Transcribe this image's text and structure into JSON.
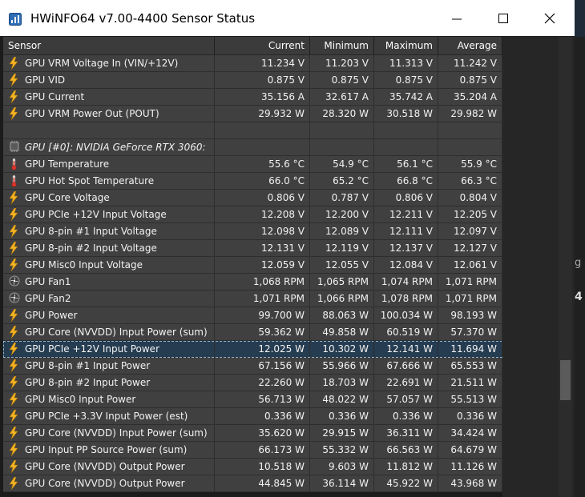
{
  "window": {
    "title": "HWiNFO64 v7.00-4400 Sensor Status",
    "minimize": "minimize",
    "maximize": "maximize",
    "close": "close"
  },
  "columns": [
    "Sensor",
    "Current",
    "Minimum",
    "Maximum",
    "Average"
  ],
  "rows": [
    {
      "type": "sensor",
      "icon": "lightning-icon",
      "name": "GPU VRM Voltage In (VIN/+12V)",
      "cur": "11.234 V",
      "min": "11.203 V",
      "max": "11.313 V",
      "avg": "11.242 V"
    },
    {
      "type": "sensor",
      "icon": "lightning-icon",
      "name": "GPU VID",
      "cur": "0.875 V",
      "min": "0.875 V",
      "max": "0.875 V",
      "avg": "0.875 V"
    },
    {
      "type": "sensor",
      "icon": "lightning-icon",
      "name": "GPU Current",
      "cur": "35.156 A",
      "min": "32.617 A",
      "max": "35.742 A",
      "avg": "35.204 A"
    },
    {
      "type": "sensor",
      "icon": "lightning-icon",
      "name": "GPU VRM Power Out (POUT)",
      "cur": "29.932 W",
      "min": "28.320 W",
      "max": "30.518 W",
      "avg": "29.982 W"
    },
    {
      "type": "blank"
    },
    {
      "type": "group",
      "icon": "chip-icon",
      "name": "GPU [#0]: NVIDIA GeForce RTX 3060:"
    },
    {
      "type": "sensor",
      "icon": "thermometer-icon",
      "name": "GPU Temperature",
      "cur": "55.6 °C",
      "min": "54.9 °C",
      "max": "56.1 °C",
      "avg": "55.9 °C"
    },
    {
      "type": "sensor",
      "icon": "thermometer-icon",
      "name": "GPU Hot Spot Temperature",
      "cur": "66.0 °C",
      "min": "65.2 °C",
      "max": "66.8 °C",
      "avg": "66.3 °C"
    },
    {
      "type": "sensor",
      "icon": "lightning-icon",
      "name": "GPU Core Voltage",
      "cur": "0.806 V",
      "min": "0.787 V",
      "max": "0.806 V",
      "avg": "0.804 V"
    },
    {
      "type": "sensor",
      "icon": "lightning-icon",
      "name": "GPU PCIe +12V Input Voltage",
      "cur": "12.208 V",
      "min": "12.200 V",
      "max": "12.211 V",
      "avg": "12.205 V"
    },
    {
      "type": "sensor",
      "icon": "lightning-icon",
      "name": "GPU 8-pin #1 Input Voltage",
      "cur": "12.098 V",
      "min": "12.089 V",
      "max": "12.111 V",
      "avg": "12.097 V"
    },
    {
      "type": "sensor",
      "icon": "lightning-icon",
      "name": "GPU 8-pin #2 Input Voltage",
      "cur": "12.131 V",
      "min": "12.119 V",
      "max": "12.137 V",
      "avg": "12.127 V"
    },
    {
      "type": "sensor",
      "icon": "lightning-icon",
      "name": "GPU Misc0 Input Voltage",
      "cur": "12.059 V",
      "min": "12.055 V",
      "max": "12.084 V",
      "avg": "12.061 V"
    },
    {
      "type": "sensor",
      "icon": "fan-icon",
      "name": "GPU Fan1",
      "cur": "1,068 RPM",
      "min": "1,065 RPM",
      "max": "1,074 RPM",
      "avg": "1,071 RPM"
    },
    {
      "type": "sensor",
      "icon": "fan-icon",
      "name": "GPU Fan2",
      "cur": "1,071 RPM",
      "min": "1,066 RPM",
      "max": "1,078 RPM",
      "avg": "1,071 RPM"
    },
    {
      "type": "sensor",
      "icon": "lightning-icon",
      "name": "GPU Power",
      "cur": "99.700 W",
      "min": "88.063 W",
      "max": "100.034 W",
      "avg": "98.193 W"
    },
    {
      "type": "sensor",
      "icon": "lightning-icon",
      "name": "GPU Core (NVVDD) Input Power (sum)",
      "cur": "59.362 W",
      "min": "49.858 W",
      "max": "60.519 W",
      "avg": "57.370 W"
    },
    {
      "type": "sensor",
      "icon": "lightning-icon",
      "name": "GPU PCIe +12V Input Power",
      "cur": "12.025 W",
      "min": "10.302 W",
      "max": "12.141 W",
      "avg": "11.694 W",
      "selected": true
    },
    {
      "type": "sensor",
      "icon": "lightning-icon",
      "name": "GPU 8-pin #1 Input Power",
      "cur": "67.156 W",
      "min": "55.966 W",
      "max": "67.666 W",
      "avg": "65.553 W"
    },
    {
      "type": "sensor",
      "icon": "lightning-icon",
      "name": "GPU 8-pin #2 Input Power",
      "cur": "22.260 W",
      "min": "18.703 W",
      "max": "22.691 W",
      "avg": "21.511 W"
    },
    {
      "type": "sensor",
      "icon": "lightning-icon",
      "name": "GPU Misc0 Input Power",
      "cur": "56.713 W",
      "min": "48.022 W",
      "max": "57.057 W",
      "avg": "55.513 W"
    },
    {
      "type": "sensor",
      "icon": "lightning-icon",
      "name": "GPU PCIe +3.3V Input Power (est)",
      "cur": "0.336 W",
      "min": "0.336 W",
      "max": "0.336 W",
      "avg": "0.336 W"
    },
    {
      "type": "sensor",
      "icon": "lightning-icon",
      "name": "GPU Core (NVVDD) Input Power (sum)",
      "cur": "35.620 W",
      "min": "29.915 W",
      "max": "36.311 W",
      "avg": "34.424 W"
    },
    {
      "type": "sensor",
      "icon": "lightning-icon",
      "name": "GPU Input PP Source Power (sum)",
      "cur": "66.173 W",
      "min": "55.332 W",
      "max": "66.563 W",
      "avg": "64.679 W"
    },
    {
      "type": "sensor",
      "icon": "lightning-icon",
      "name": "GPU Core (NVVDD) Output Power",
      "cur": "10.518 W",
      "min": "9.603 W",
      "max": "11.812 W",
      "avg": "11.126 W"
    },
    {
      "type": "sensor",
      "icon": "lightning-icon",
      "name": "GPU Core (NVVDD) Output Power",
      "cur": "44.845 W",
      "min": "36.114 W",
      "max": "45.922 W",
      "avg": "43.968 W"
    }
  ],
  "background_window_fragments": [
    "g",
    "4"
  ],
  "colors": {
    "row_bg": "#404040",
    "selected_bg": "#253c51",
    "text": "#f2f2f2",
    "icon_bolt": "#f5b324",
    "icon_thermo": "#d9342b"
  }
}
